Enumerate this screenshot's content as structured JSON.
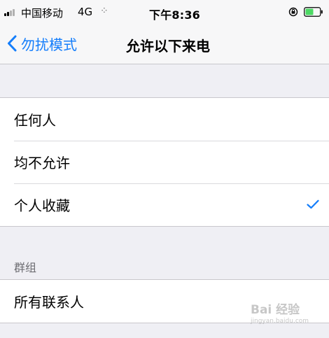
{
  "status_bar": {
    "carrier": "中国移动",
    "network": "4G",
    "activity_glyph": "⁘",
    "time": "下午8:36",
    "icons": [
      "signal-icon",
      "rotation-lock-icon",
      "battery-icon"
    ],
    "battery_color": "#4cd964"
  },
  "nav": {
    "back_label": "勿扰模式",
    "title": "允许以下来电",
    "accent_color": "#157efb"
  },
  "options": {
    "items": [
      {
        "label": "任何人",
        "selected": false
      },
      {
        "label": "均不允许",
        "selected": false
      },
      {
        "label": "个人收藏",
        "selected": true
      }
    ]
  },
  "groups_section": {
    "header": "群组",
    "items": [
      {
        "label": "所有联系人"
      }
    ]
  },
  "watermark": {
    "text": "Bai 经验",
    "sub": "jingyan.baidu.com"
  }
}
